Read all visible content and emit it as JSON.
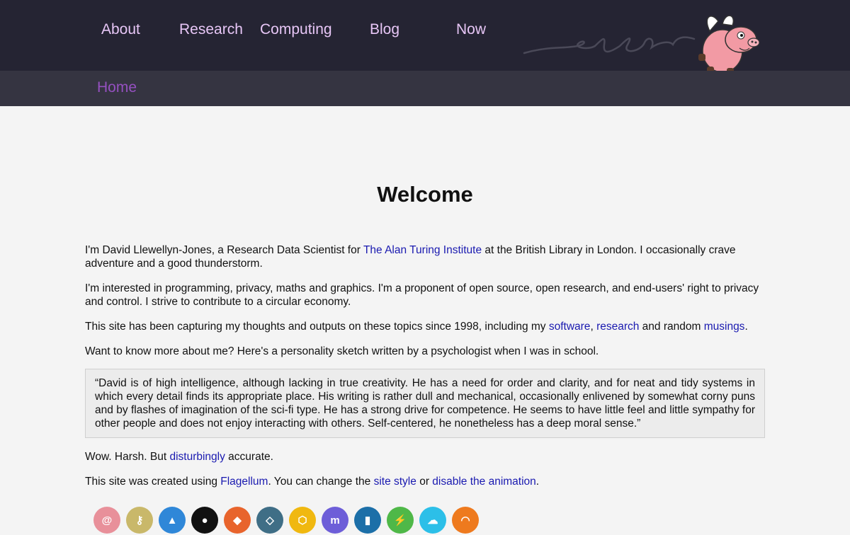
{
  "nav": {
    "items": [
      "About",
      "Research",
      "Computing",
      "Blog",
      "Now"
    ]
  },
  "breadcrumb": {
    "home": "Home"
  },
  "main": {
    "title": "Welcome",
    "p1": {
      "a": "I'm David Llewellyn-Jones, a Research Data Scientist for ",
      "link": "The Alan Turing Institute",
      "b": " at the British Library in London. I occasionally crave adventure and a good thunderstorm."
    },
    "p2": "I'm interested in programming, privacy, maths and graphics. I'm a proponent of open source, open research, and end-users' right to privacy and control. I strive to contribute to a circular economy.",
    "p3": {
      "a": "This site has been capturing my thoughts and outputs on these topics since 1998, including my ",
      "link1": "software",
      "sep": ", ",
      "link2": "research",
      "b": " and random ",
      "link3": "musings",
      "c": "."
    },
    "p4": "Want to know more about me? Here's a personality sketch written by a psychologist when I was in school.",
    "quote": "“David is of high intelligence, although lacking in true creativity. He has a need for order and clarity, and for neat and tidy systems in which every detail finds its appropriate place. His writing is rather dull and mechanical, occasionally enlivened by somewhat corny puns and by flashes of imagination of the sci-fi type. He has a strong drive for competence. He seems to have little feel and little sympathy for other people and does not enjoy interacting with others. Self-centered, he nonetheless has a deep moral sense.”",
    "p5": {
      "a": "Wow. Harsh. But ",
      "link": "disturbingly",
      "b": " accurate."
    },
    "p6": {
      "a": "This site was created using ",
      "link1": "Flagellum",
      "b": ". You can change the ",
      "link2": "site style",
      "c": " or ",
      "link3": "disable the animation",
      "d": "."
    }
  },
  "social_icons": [
    {
      "name": "email-icon",
      "color": "#e8909a"
    },
    {
      "name": "key-icon",
      "color": "#c9b86a"
    },
    {
      "name": "drop-icon",
      "color": "#2f87d8"
    },
    {
      "name": "github-icon",
      "color": "#111111"
    },
    {
      "name": "gitlab-icon",
      "color": "#e8642c"
    },
    {
      "name": "sourceforge-icon",
      "color": "#3f6e86"
    },
    {
      "name": "hex-icon",
      "color": "#f0b810"
    },
    {
      "name": "mastodon-icon",
      "color": "#6d5ed8"
    },
    {
      "name": "linkedin-icon",
      "color": "#1c6fa8"
    },
    {
      "name": "bolt-icon",
      "color": "#4fb848"
    },
    {
      "name": "cloud-icon",
      "color": "#2cbfe8"
    },
    {
      "name": "rss-icon",
      "color": "#ee7a1e"
    }
  ]
}
